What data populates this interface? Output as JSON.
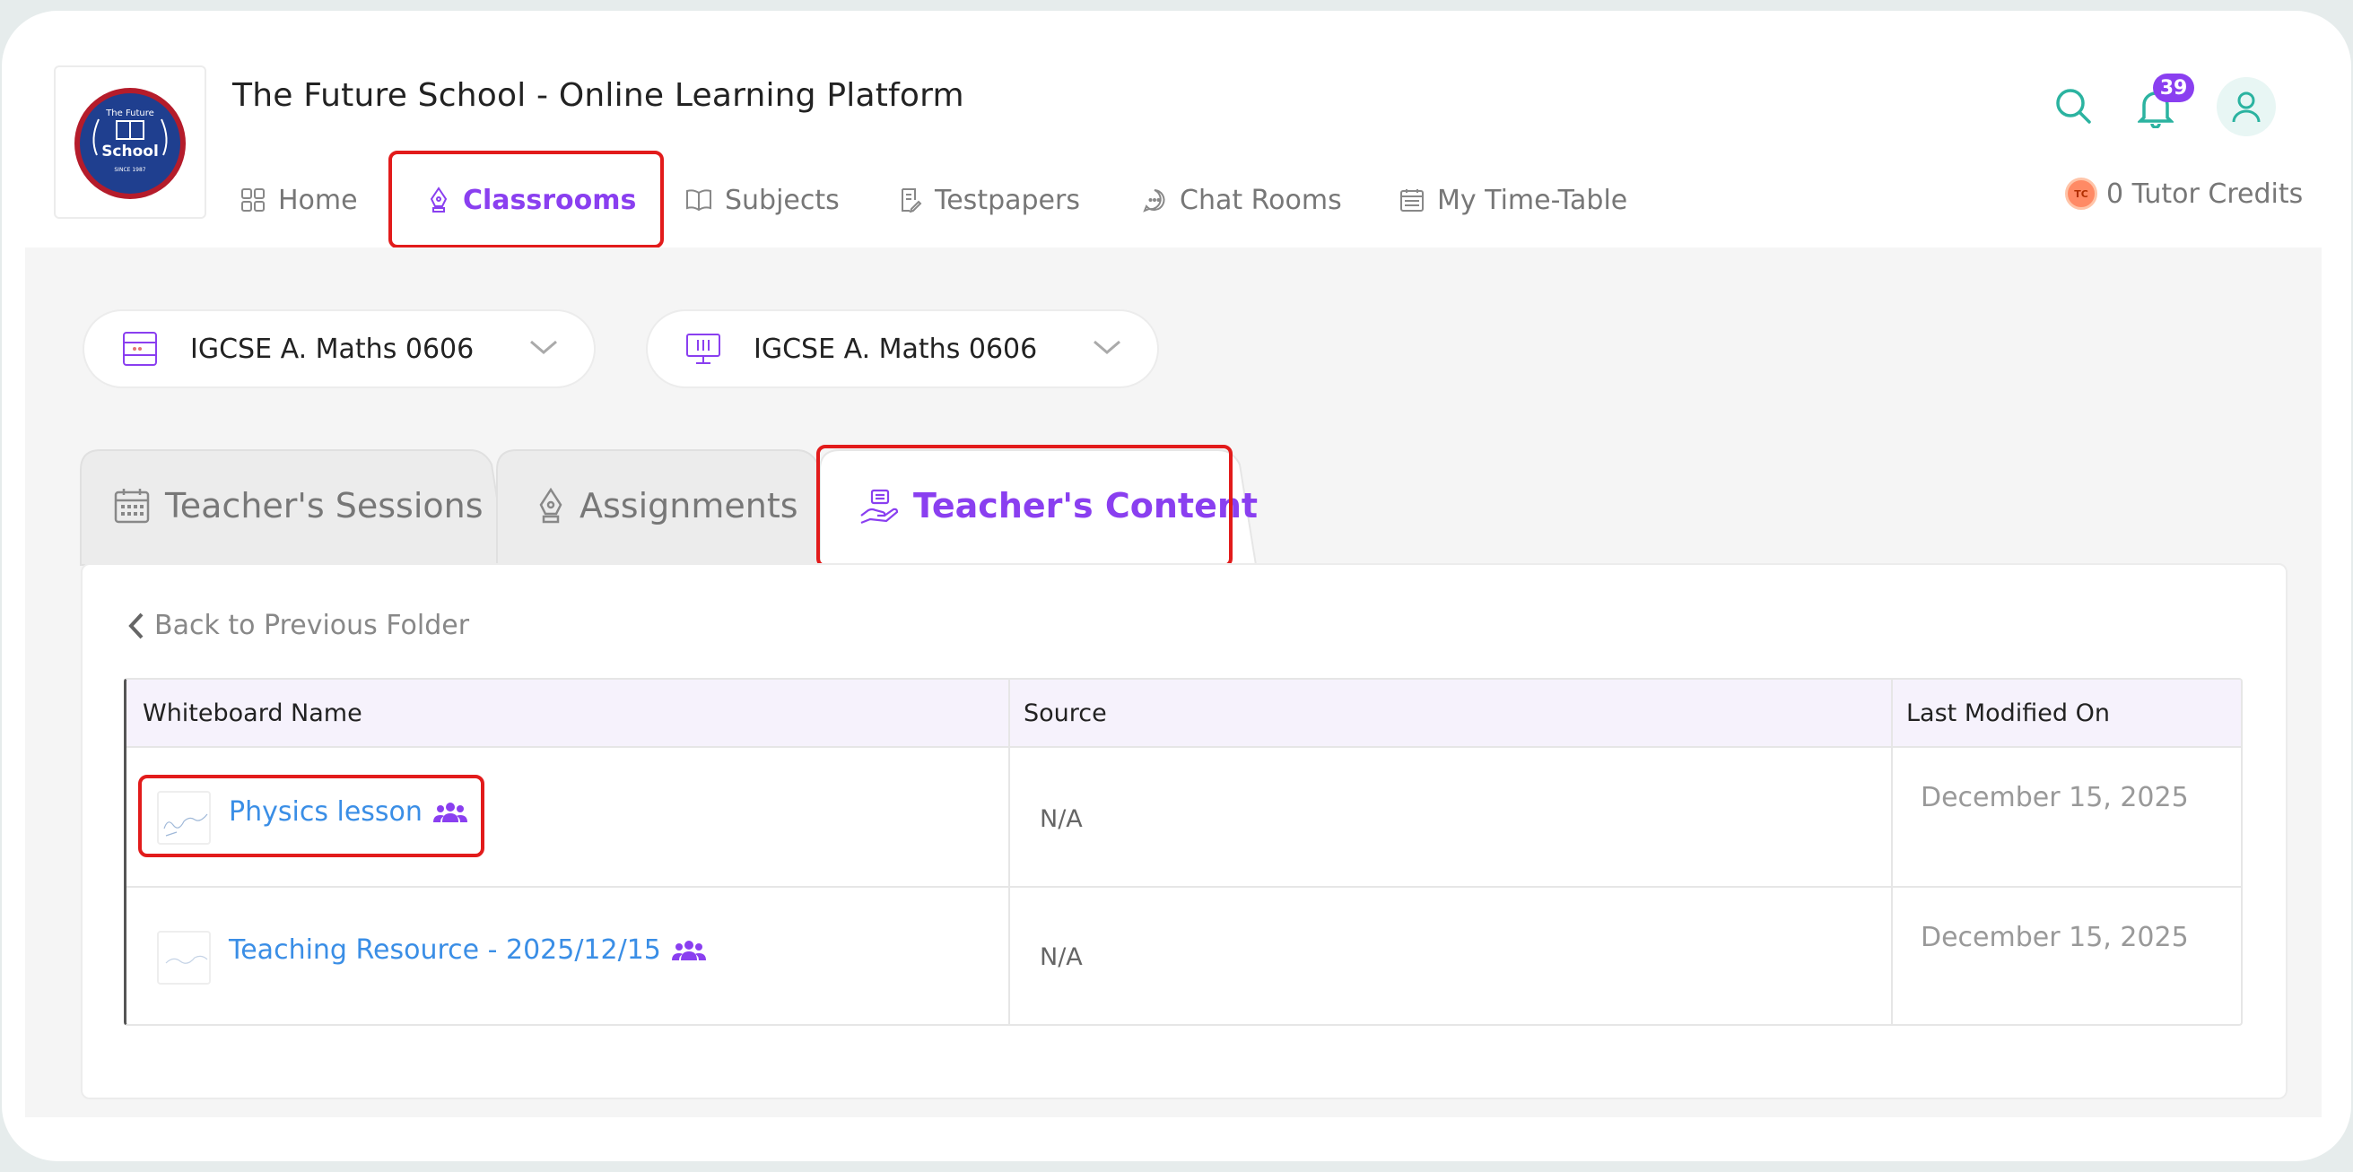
{
  "app": {
    "title": "The Future School - Online Learning Platform",
    "logo": {
      "top_text": "The Future",
      "main_text": "School",
      "bottom_text": "SINCE 1987"
    }
  },
  "nav": {
    "items": [
      {
        "label": "Home",
        "icon": "grid-icon"
      },
      {
        "label": "Classrooms",
        "icon": "pen-nib-icon",
        "active": true
      },
      {
        "label": "Subjects",
        "icon": "book-icon"
      },
      {
        "label": "Testpapers",
        "icon": "edit-doc-icon"
      },
      {
        "label": "Chat Rooms",
        "icon": "chat-icon"
      },
      {
        "label": "My Time-Table",
        "icon": "calendar-icon"
      }
    ]
  },
  "header": {
    "notification_count": "39",
    "credits_label": "0 Tutor Credits",
    "coin_text": "TC"
  },
  "selectors": [
    {
      "value": "IGCSE A. Maths 0606",
      "icon": "abacus-icon"
    },
    {
      "value": "IGCSE A. Maths 0606",
      "icon": "presentation-board-icon"
    }
  ],
  "tabs": [
    {
      "label": "Teacher's Sessions",
      "icon": "calendar-icon"
    },
    {
      "label": "Assignments",
      "icon": "pen-nib-icon"
    },
    {
      "label": "Teacher's Content",
      "icon": "hand-share-icon",
      "active": true
    }
  ],
  "content": {
    "back_label": "Back to Previous Folder",
    "columns": [
      "Whiteboard Name",
      "Source",
      "Last Modified On"
    ],
    "rows": [
      {
        "name": "Physics lesson",
        "source": "N/A",
        "modified": "December 15, 2025"
      },
      {
        "name": "Teaching Resource - 2025/12/15",
        "source": "N/A",
        "modified": "December 15, 2025"
      }
    ]
  },
  "colors": {
    "accent": "#8a3ff0",
    "link": "#3a8ee6",
    "highlight": "#e21b1b",
    "teal": "#2bb3a0"
  }
}
